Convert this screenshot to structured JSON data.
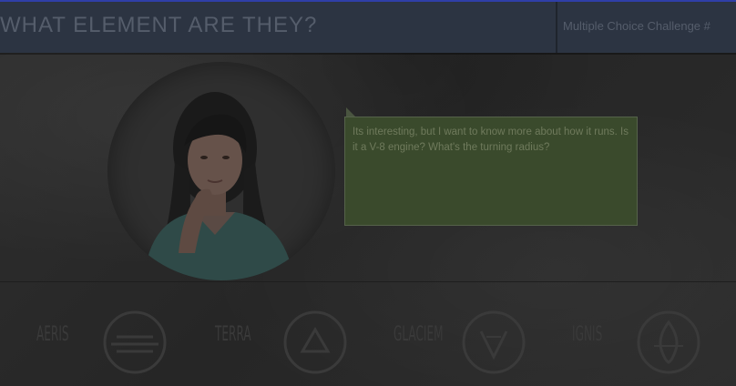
{
  "header": {
    "title": "WHAT ELEMENT ARE THEY?",
    "challenge": "Multiple Choice Challenge #"
  },
  "speech": {
    "text": "Its interesting, but I want to know more about how it runs. Is it a V-8 engine? What's the turning radius?"
  },
  "elements": [
    {
      "label": "AERIS",
      "icon": "air-symbol-icon"
    },
    {
      "label": "TERRA",
      "icon": "earth-symbol-icon"
    },
    {
      "label": "GLACIEM",
      "icon": "water-symbol-icon"
    },
    {
      "label": "IGNIS",
      "icon": "fire-symbol-icon"
    }
  ],
  "colors": {
    "header_bg": "#2c3442",
    "top_border": "#2f3fa8",
    "bubble_bg": "#3a4a2c"
  }
}
